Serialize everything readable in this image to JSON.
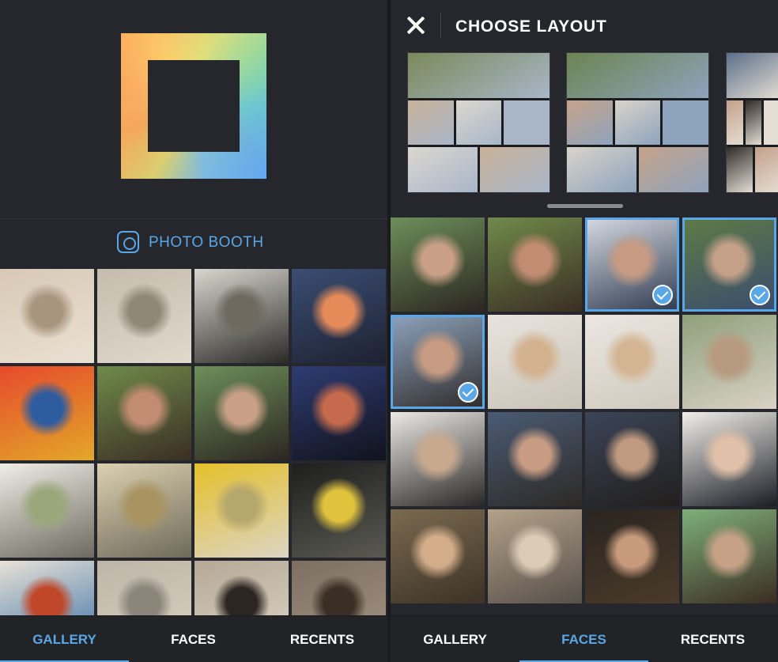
{
  "left": {
    "photo_booth_label": "PHOTO BOOTH",
    "tabs": [
      {
        "label": "GALLERY",
        "active": true
      },
      {
        "label": "FACES",
        "active": false
      },
      {
        "label": "RECENTS",
        "active": false
      }
    ],
    "photos": [
      {
        "name": "photo-bulldog",
        "colors": [
          "#d8c9b6",
          "#a8957e",
          "#eae0d2"
        ]
      },
      {
        "name": "photo-rock-cliff",
        "colors": [
          "#c4bcad",
          "#8f8778",
          "#e0d9cc"
        ]
      },
      {
        "name": "photo-beach-rocks",
        "colors": [
          "#d9d6cf",
          "#6f6a60",
          "#2b2a27"
        ]
      },
      {
        "name": "photo-sunset-silhouette",
        "colors": [
          "#3b4d73",
          "#e58b5a",
          "#1d2231"
        ]
      },
      {
        "name": "photo-balloons",
        "colors": [
          "#e64a2c",
          "#2d5c9f",
          "#e3a72a"
        ]
      },
      {
        "name": "photo-girl-selfie",
        "colors": [
          "#6f8a4a",
          "#c18c72",
          "#3b2e24"
        ]
      },
      {
        "name": "photo-two-girls",
        "colors": [
          "#6d8f5a",
          "#c9a086",
          "#2c2621"
        ]
      },
      {
        "name": "photo-palm-dusk",
        "colors": [
          "#2f3c73",
          "#c56a4c",
          "#11131c"
        ]
      },
      {
        "name": "photo-child-house",
        "colors": [
          "#f0ede6",
          "#9aa77b",
          "#6d6a60"
        ]
      },
      {
        "name": "photo-cupcakes",
        "colors": [
          "#dcd0b0",
          "#a99461",
          "#6f6a5a"
        ]
      },
      {
        "name": "photo-flowers",
        "colors": [
          "#e5c02a",
          "#b6a76c",
          "#dcd5c4"
        ]
      },
      {
        "name": "photo-bike-leaves",
        "colors": [
          "#1e1e1e",
          "#e0c23d",
          "#5a5a52"
        ]
      },
      {
        "name": "photo-coffee",
        "colors": [
          "#e7e1d7",
          "#c0472a",
          "#3a71a6"
        ]
      },
      {
        "name": "photo-sidewalk",
        "colors": [
          "#bdb6a8",
          "#8c8579",
          "#d9d2c2"
        ]
      },
      {
        "name": "photo-puppy-bench",
        "colors": [
          "#b5a895",
          "#2b2620",
          "#ddd6c9"
        ]
      },
      {
        "name": "photo-puppy-deck",
        "colors": [
          "#7c6f62",
          "#3a2f25",
          "#a69584"
        ]
      }
    ]
  },
  "right": {
    "title": "CHOOSE LAYOUT",
    "tabs": [
      {
        "label": "GALLERY",
        "active": false
      },
      {
        "label": "FACES",
        "active": true
      },
      {
        "label": "RECENTS",
        "active": false
      }
    ],
    "layouts": [
      {
        "name": "layout-option-1",
        "colors": [
          "#7a8a5a",
          "#c9b29a",
          "#dcd7d0",
          "#a8b6c8"
        ]
      },
      {
        "name": "layout-option-2",
        "colors": [
          "#6c8452",
          "#c6a38a",
          "#d9d4ca",
          "#8ea3bd"
        ]
      },
      {
        "name": "layout-option-3",
        "colors": [
          "#5c6f8a",
          "#c4a08a",
          "#2f2b29",
          "#e3ddd3"
        ]
      }
    ],
    "photos": [
      {
        "name": "face-two-girls",
        "colors": [
          "#6d8f5a",
          "#c9a086",
          "#2c2621"
        ],
        "selected": false
      },
      {
        "name": "face-girl-selfie",
        "colors": [
          "#6f8a4a",
          "#c18c72",
          "#3b2e24"
        ],
        "selected": false
      },
      {
        "name": "face-three-friends",
        "colors": [
          "#d5dbe3",
          "#c79a82",
          "#2f3a4f"
        ],
        "selected": true
      },
      {
        "name": "face-lying-grass",
        "colors": [
          "#5e7b45",
          "#c4a088",
          "#3a4c6f"
        ],
        "selected": true
      },
      {
        "name": "face-beach-selfie",
        "colors": [
          "#8ea3bd",
          "#c79b81",
          "#2f2b2a"
        ],
        "selected": true
      },
      {
        "name": "face-blonde-beach",
        "colors": [
          "#e8e4dd",
          "#d2b28f",
          "#c9c3b8"
        ],
        "selected": false
      },
      {
        "name": "face-blonde-beach-2",
        "colors": [
          "#ebe7e0",
          "#d3b593",
          "#cfc9be"
        ],
        "selected": false
      },
      {
        "name": "face-girl-rocks",
        "colors": [
          "#8fa07c",
          "#b7997f",
          "#d9d2c5"
        ],
        "selected": false
      },
      {
        "name": "face-sunglasses",
        "colors": [
          "#eceae6",
          "#c8a98e",
          "#2a2826"
        ],
        "selected": false
      },
      {
        "name": "face-couple-selfie",
        "colors": [
          "#4a5b74",
          "#c79c82",
          "#2d2a27"
        ],
        "selected": false
      },
      {
        "name": "face-funny-trio",
        "colors": [
          "#3b4558",
          "#c09a80",
          "#221f1d"
        ],
        "selected": false
      },
      {
        "name": "face-glasses-man",
        "colors": [
          "#f1efea",
          "#e0c0a8",
          "#1c1e26"
        ],
        "selected": false
      },
      {
        "name": "face-girl-phone",
        "colors": [
          "#7a6a50",
          "#d3ad8a",
          "#3c3226"
        ],
        "selected": false
      },
      {
        "name": "face-girl-striped",
        "colors": [
          "#b3a189",
          "#dccbb6",
          "#57504a"
        ],
        "selected": false
      },
      {
        "name": "face-group-night",
        "colors": [
          "#2a2520",
          "#c79a7c",
          "#4a3a2a"
        ],
        "selected": false
      },
      {
        "name": "face-girls-dog",
        "colors": [
          "#7fb07a",
          "#c6a186",
          "#3a2c22"
        ],
        "selected": false
      }
    ]
  }
}
